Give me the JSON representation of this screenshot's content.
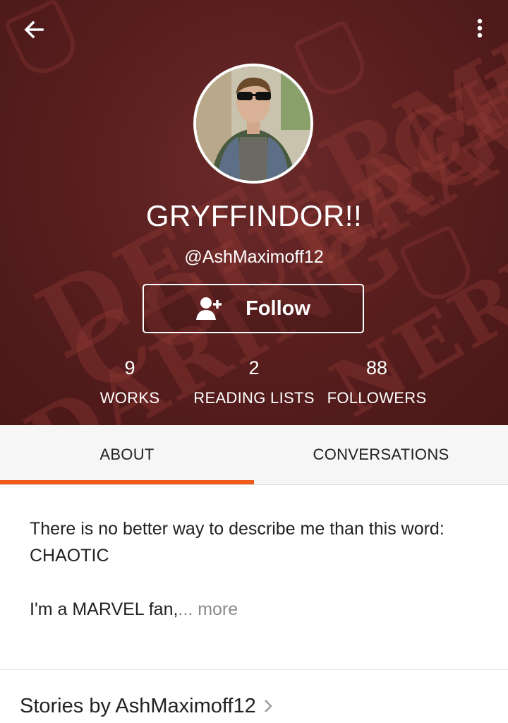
{
  "header": {
    "background_words": [
      "DETERMINATION",
      "COURAGE",
      "BRAVERY",
      "DARING",
      "NERVE",
      "CHIVALRY"
    ],
    "back_icon": "arrow-left-icon",
    "menu_icon": "more-vertical-icon"
  },
  "profile": {
    "display_name": "GRYFFINDOR!!",
    "username": "@AshMaximoff12",
    "follow_label": "Follow",
    "follow_icon": "add-user-icon"
  },
  "stats": [
    {
      "value": "9",
      "label": "WORKS"
    },
    {
      "value": "2",
      "label": "READING LISTS"
    },
    {
      "value": "88",
      "label": "FOLLOWERS"
    }
  ],
  "tabs": [
    {
      "label": "ABOUT",
      "active": true
    },
    {
      "label": "CONVERSATIONS",
      "active": false
    }
  ],
  "about": {
    "line1": "There is no better way to describe me than this word: CHAOTIC",
    "line2": "I'm a MARVEL fan,",
    "more": "... more"
  },
  "stories": {
    "title": "Stories by AshMaximoff12",
    "chevron_icon": "chevron-right-icon"
  },
  "colors": {
    "accent": "#f05a1a",
    "header_bg": "#5a1f1f"
  }
}
